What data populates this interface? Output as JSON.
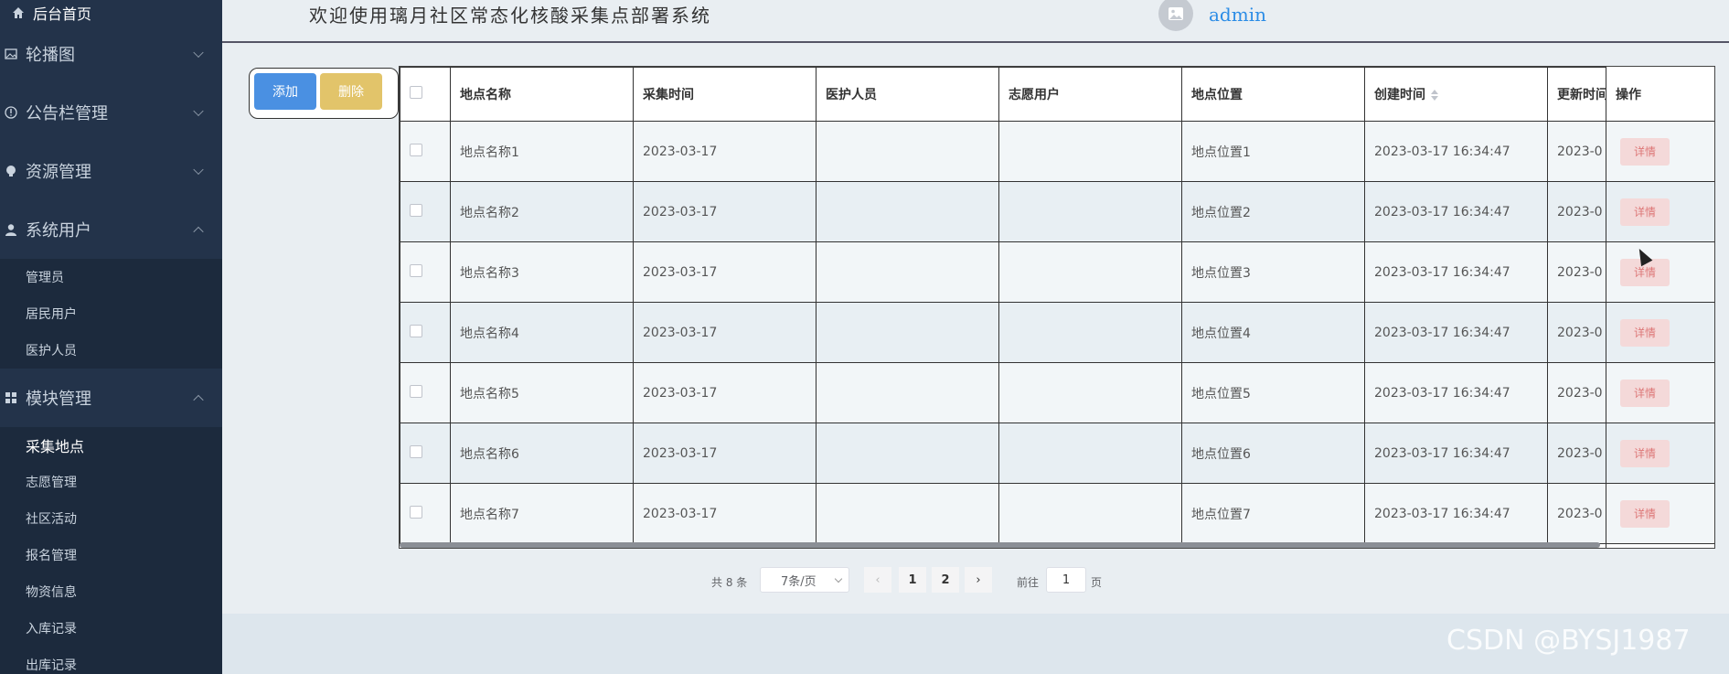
{
  "sidebar": {
    "home": "后台首页",
    "menus": [
      {
        "label": "轮播图",
        "icon": "image-icon"
      },
      {
        "label": "公告栏管理",
        "icon": "info-icon"
      },
      {
        "label": "资源管理",
        "icon": "bulb-icon"
      },
      {
        "label": "系统用户",
        "icon": "user-icon"
      },
      {
        "label": "模块管理",
        "icon": "grid-icon"
      }
    ],
    "system_users_sub": [
      "管理员",
      "居民用户",
      "医护人员"
    ],
    "module_sub": [
      "采集地点",
      "志愿管理",
      "社区活动",
      "报名管理",
      "物资信息",
      "入库记录",
      "出库记录"
    ]
  },
  "header": {
    "title": "欢迎使用璃月社区常态化核酸采集点部署系统",
    "user": "admin"
  },
  "toolbar": {
    "add": "添加",
    "delete": "删除"
  },
  "table": {
    "columns": [
      "地点名称",
      "采集时间",
      "医护人员",
      "志愿用户",
      "地点位置",
      "创建时间",
      "更新时间",
      "操作"
    ],
    "rows": [
      {
        "name": "地点名称1",
        "time": "2023-03-17",
        "medic": "",
        "volunteer": "",
        "location": "地点位置1",
        "created": "2023-03-17 16:34:47",
        "updated": "2023-0"
      },
      {
        "name": "地点名称2",
        "time": "2023-03-17",
        "medic": "",
        "volunteer": "",
        "location": "地点位置2",
        "created": "2023-03-17 16:34:47",
        "updated": "2023-0"
      },
      {
        "name": "地点名称3",
        "time": "2023-03-17",
        "medic": "",
        "volunteer": "",
        "location": "地点位置3",
        "created": "2023-03-17 16:34:47",
        "updated": "2023-0"
      },
      {
        "name": "地点名称4",
        "time": "2023-03-17",
        "medic": "",
        "volunteer": "",
        "location": "地点位置4",
        "created": "2023-03-17 16:34:47",
        "updated": "2023-0"
      },
      {
        "name": "地点名称5",
        "time": "2023-03-17",
        "medic": "",
        "volunteer": "",
        "location": "地点位置5",
        "created": "2023-03-17 16:34:47",
        "updated": "2023-0"
      },
      {
        "name": "地点名称6",
        "time": "2023-03-17",
        "medic": "",
        "volunteer": "",
        "location": "地点位置6",
        "created": "2023-03-17 16:34:47",
        "updated": "2023-0"
      },
      {
        "name": "地点名称7",
        "time": "2023-03-17",
        "medic": "",
        "volunteer": "",
        "location": "地点位置7",
        "created": "2023-03-17 16:34:47",
        "updated": "2023-0"
      }
    ],
    "detail_label": "详情"
  },
  "pagination": {
    "total": "共 8 条",
    "page_size": "7条/页",
    "pages": [
      "1",
      "2"
    ],
    "goto_label": "前往",
    "goto_value": "1",
    "page_suffix": "页"
  },
  "watermark": "CSDN @BYSJ1987"
}
